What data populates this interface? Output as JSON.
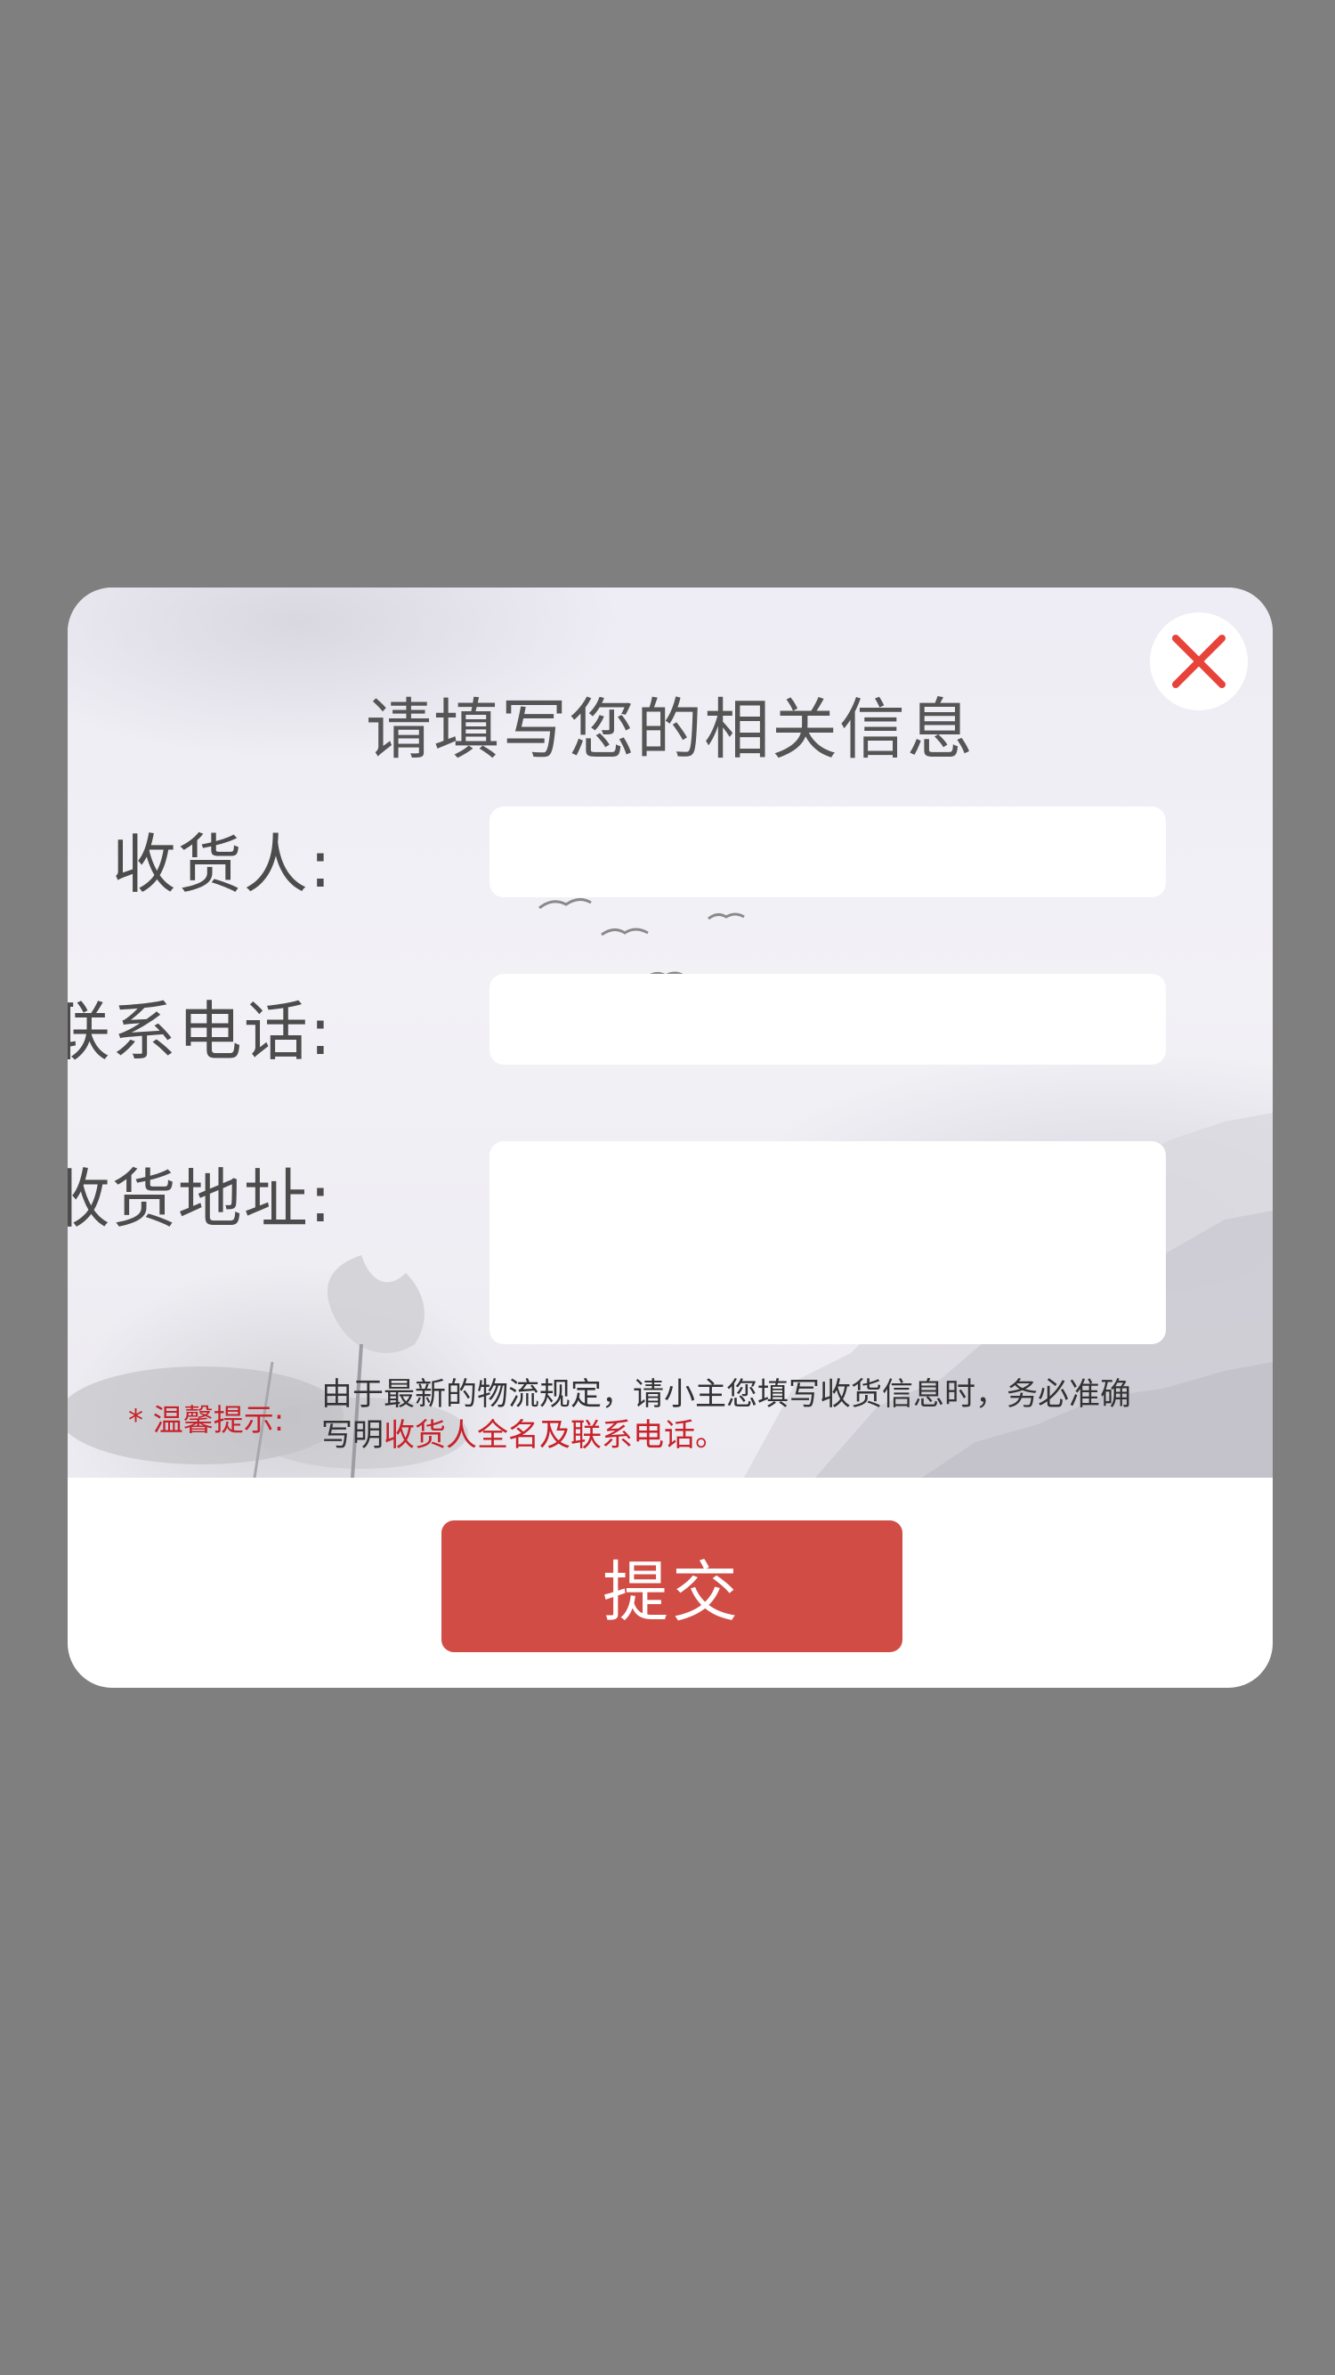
{
  "modal": {
    "title": "请填写您的相关信息",
    "close_icon": "close-icon",
    "fields": [
      {
        "label": "收货人:",
        "value": "",
        "placeholder": ""
      },
      {
        "label": "联系电话:",
        "value": "",
        "placeholder": ""
      },
      {
        "label": "收货地址:",
        "value": "",
        "placeholder": ""
      }
    ],
    "tip": {
      "label": "* 温馨提示:",
      "text_plain": "由于最新的物流规定，请小主您填写收货信息时，务必准确写明",
      "text_highlight": "收货人全名及联系电话。"
    },
    "submit_label": "提交"
  },
  "colors": {
    "backdrop": "#7f7f7f",
    "accent_red": "#d24c46",
    "tip_red": "#c8222a",
    "close_x": "#e8433a"
  }
}
